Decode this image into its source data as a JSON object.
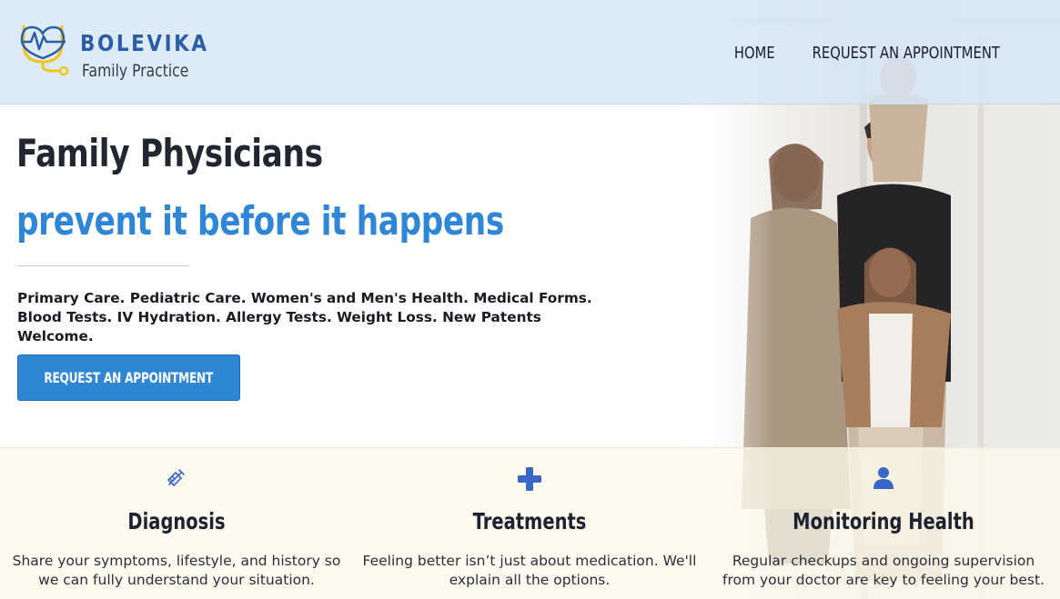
{
  "brand": {
    "name": "BOLEVIKA",
    "subtitle": "Family Practice",
    "colors": {
      "primary": "#2f86d4",
      "logo_blue": "#2c5ea8",
      "logo_yellow": "#f0c419"
    }
  },
  "nav": {
    "items": [
      {
        "label": "HOME"
      },
      {
        "label": "REQUEST AN APPOINTMENT"
      }
    ]
  },
  "hero": {
    "title": "Family Physicians",
    "tagline": "prevent it before it happens",
    "description": "Primary Care. Pediatric Care. Women's and Men's Health. Medical Forms. Blood Tests. IV Hydration. Allergy Tests. Weight Loss. New Patents Welcome.",
    "cta_label": "REQUEST AN APPOINTMENT"
  },
  "features": [
    {
      "icon": "syringe-icon",
      "title": "Diagnosis",
      "text": "Share your symptoms, lifestyle, and history so we can fully understand your situation."
    },
    {
      "icon": "plus-icon",
      "title": "Treatments",
      "text": "Feeling better isn’t just about medication. We'll explain all the options."
    },
    {
      "icon": "user-icon",
      "title": "Monitoring Health",
      "text": "Regular checkups and ongoing supervision from your doctor are key to feeling your best."
    }
  ]
}
